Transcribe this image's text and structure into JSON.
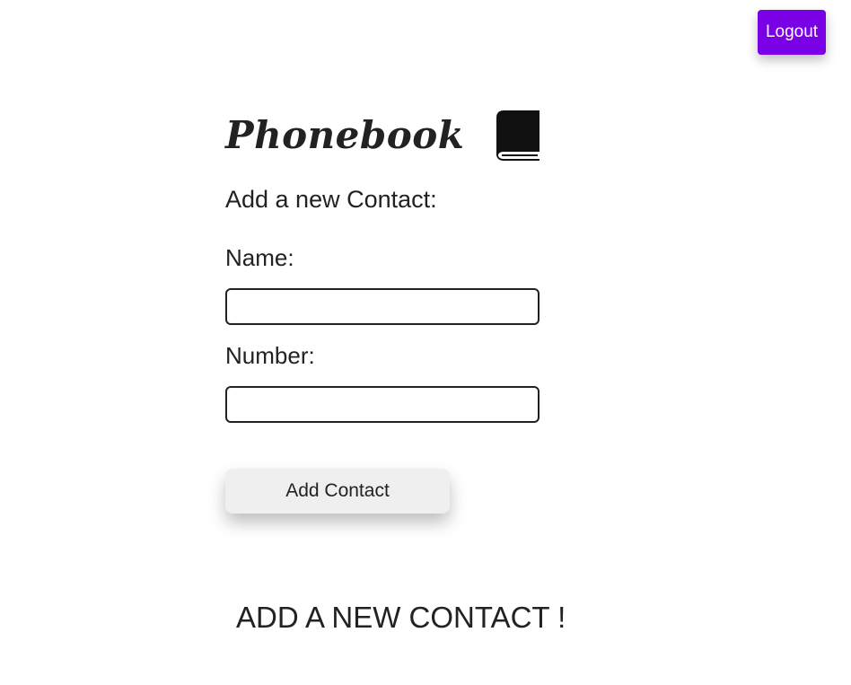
{
  "header": {
    "logout_label": "Logout",
    "logout_color": "#7a00e6"
  },
  "main": {
    "title": "Phonebook",
    "title_icon": "book-icon",
    "subtitle": "Add a new Contact:",
    "form": {
      "name_label": "Name:",
      "name_value": "",
      "number_label": "Number:",
      "number_value": "",
      "submit_label": "Add Contact"
    },
    "empty_message": "ADD A NEW CONTACT !"
  }
}
